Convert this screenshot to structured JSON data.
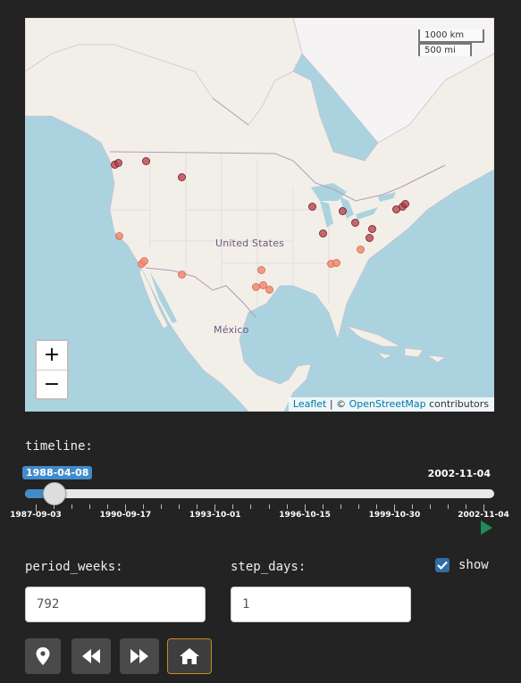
{
  "map": {
    "label_country": "United States",
    "label_mexico": "México",
    "scale_km": "1000 km",
    "scale_mi": "500 mi",
    "zoom_in": "+",
    "zoom_out": "−",
    "attribution_leaflet": "Leaflet",
    "attribution_sep": " | © ",
    "attribution_osm": "OpenStreetMap",
    "attribution_suffix": " contributors",
    "marker_colors": {
      "dark": "#b23c46",
      "light": "#f08c6e"
    }
  },
  "timeline": {
    "label": "timeline:",
    "current": "1988-04-08",
    "max": "2002-11-04",
    "tick_labels": [
      "1987-09-03",
      "1990-09-17",
      "1993-10-01",
      "1996-10-15",
      "1999-10-30",
      "2002-11-04"
    ],
    "accent": "#428bca",
    "play_icon": "play-icon"
  },
  "inputs": {
    "period_label": "period_weeks:",
    "period_value": "792",
    "step_label": "step_days:",
    "step_value": "1",
    "show_label": "show",
    "show_checked": true
  },
  "buttons": [
    {
      "icon": "map-marker-icon"
    },
    {
      "icon": "backward-icon"
    },
    {
      "icon": "forward-icon"
    },
    {
      "icon": "home-icon"
    }
  ]
}
